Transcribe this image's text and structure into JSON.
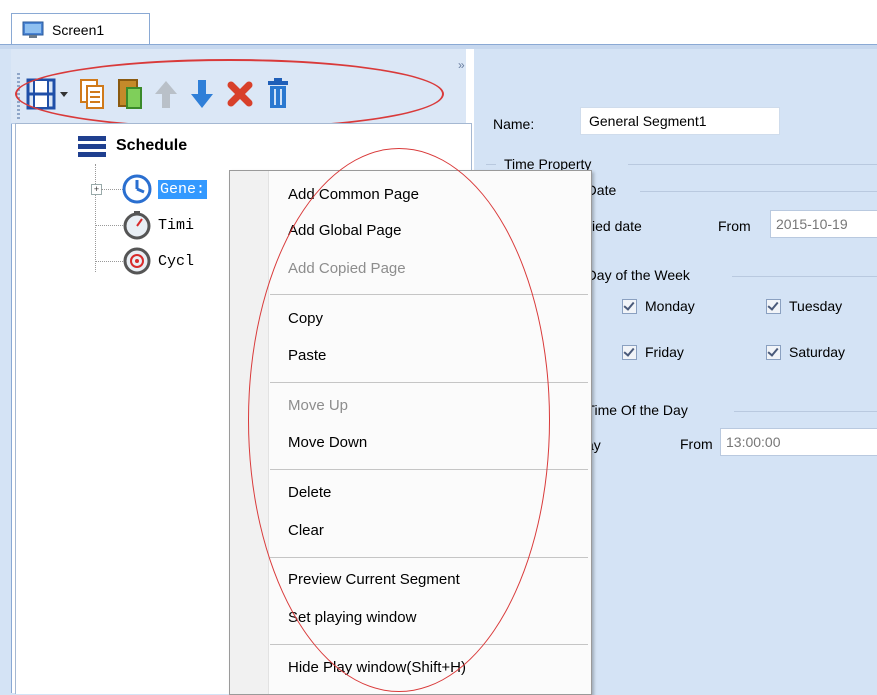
{
  "tabs": [
    {
      "label": "Screen1"
    }
  ],
  "toolbar": {
    "buttons": [
      "film-dropdown-button",
      "copy-page-button",
      "paste-page-button",
      "move-up-button",
      "move-down-button",
      "delete-button",
      "clear-button"
    ],
    "more": "»"
  },
  "tree": {
    "root": "Schedule",
    "items": [
      {
        "label": "Gene:",
        "icon": "clock-icon",
        "selected": true
      },
      {
        "label": "Timi",
        "icon": "stopwatch-icon"
      },
      {
        "label": "Cycl",
        "icon": "cycle-icon"
      }
    ]
  },
  "form": {
    "name_label": "Name:",
    "name_value": "General Segment1",
    "time_property": "Time Property",
    "date_section": "e Date",
    "specified_date": "cified date",
    "from_label": "From",
    "date_value": "2015-10-19",
    "week_section": "e Day of the Week",
    "days": [
      {
        "label": "Monday",
        "checked": true
      },
      {
        "label": "Tuesday",
        "checked": true
      },
      {
        "label": "Friday",
        "checked": true
      },
      {
        "label": "Saturday",
        "checked": true
      }
    ],
    "time_section": "e Time Of the Day",
    "day_label": "ay",
    "time_from_label": "From",
    "time_value": "13:00:00"
  },
  "context_menu": {
    "items": [
      {
        "label": "Add Common Page",
        "enabled": true
      },
      {
        "label": "Add Global Page",
        "enabled": true
      },
      {
        "label": "Add Copied Page",
        "enabled": false
      },
      {
        "label": "Copy",
        "enabled": true
      },
      {
        "label": "Paste",
        "enabled": true
      },
      {
        "label": "Move Up",
        "enabled": false
      },
      {
        "label": "Move Down",
        "enabled": true
      },
      {
        "label": "Delete",
        "enabled": true
      },
      {
        "label": "Clear",
        "enabled": true
      },
      {
        "label": "Preview Current Segment",
        "enabled": true
      },
      {
        "label": "Set playing window",
        "enabled": true
      },
      {
        "label": "Hide Play window(Shift+H)",
        "enabled": true
      }
    ]
  },
  "colors": {
    "accent": "#3399ff",
    "annotation": "#d93a3a",
    "panel_bg": "#d4e3f5"
  }
}
